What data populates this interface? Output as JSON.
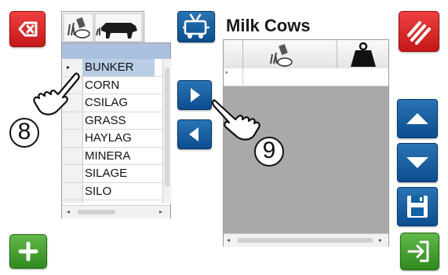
{
  "header": {
    "title": "Milk Cows"
  },
  "source_list": {
    "items": [
      {
        "label": "BUNKER",
        "selected": true
      },
      {
        "label": "CORN",
        "selected": false
      },
      {
        "label": "CSILAG",
        "selected": false
      },
      {
        "label": "GRASS",
        "selected": false
      },
      {
        "label": "HAYLAG",
        "selected": false
      },
      {
        "label": "MINERA",
        "selected": false
      },
      {
        "label": "SILAGE",
        "selected": false
      },
      {
        "label": "SILO",
        "selected": false
      }
    ]
  },
  "annotations": {
    "marker_left": "8",
    "marker_right": "9"
  },
  "icons": {
    "delete": "backspace-icon",
    "clear_all": "clear-all-icon",
    "ingredient_feed": "feed-ingredient-icon",
    "cow": "cow-icon",
    "feed_mixer": "feed-mixer-icon",
    "weight": "weight-icon",
    "add_right": "arrow-right-icon",
    "remove_left": "arrow-left-icon",
    "move_up": "arrow-up-icon",
    "move_down": "arrow-down-icon",
    "save": "save-icon",
    "add": "plus-icon",
    "next": "next-icon"
  },
  "colors": {
    "red_button": "#d42a2a",
    "blue_button": "#1262a6",
    "green_button": "#45a032",
    "selection": "#b9cde6"
  }
}
